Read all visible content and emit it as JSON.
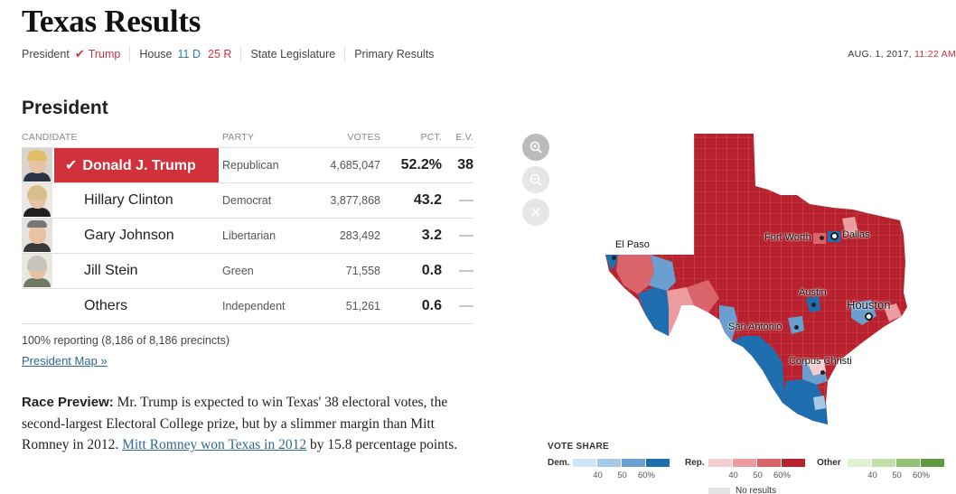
{
  "header": {
    "title": "Texas Results"
  },
  "subnav": {
    "president_label": "President",
    "president_winner": "Trump",
    "house_label": "House",
    "house_dem": "11 D",
    "house_rep": "25 R",
    "state_legislature": "State Legislature",
    "primary_results": "Primary Results",
    "date": "AUG. 1, 2017,",
    "time": "11:22 AM"
  },
  "president": {
    "section_title": "President",
    "columns": {
      "candidate": "CANDIDATE",
      "party": "PARTY",
      "votes": "VOTES",
      "pct": "PCT.",
      "ev": "E.V."
    },
    "rows": [
      {
        "name": "Donald J. Trump",
        "party": "Republican",
        "votes": "4,685,047",
        "pct": "52.2%",
        "ev": "38"
      },
      {
        "name": "Hillary Clinton",
        "party": "Democrat",
        "votes": "3,877,868",
        "pct": "43.2",
        "ev": "—"
      },
      {
        "name": "Gary Johnson",
        "party": "Libertarian",
        "votes": "283,492",
        "pct": "3.2",
        "ev": "—"
      },
      {
        "name": "Jill Stein",
        "party": "Green",
        "votes": "71,558",
        "pct": "0.8",
        "ev": "—"
      },
      {
        "name": "Others",
        "party": "Independent",
        "votes": "51,261",
        "pct": "0.6",
        "ev": "—"
      }
    ],
    "reporting": "100% reporting (8,186 of 8,186 precincts)",
    "map_link": "President Map »"
  },
  "preview": {
    "label": "Race Preview:",
    "text_before": " Mr. Trump is expected to win Texas' 38 electoral votes, the second-largest Electoral College prize, but by a slimmer margin than Mitt Romney in 2012. ",
    "link_text": "Mitt Romney won Texas in 2012",
    "text_after": " by 15.8 percentage points."
  },
  "map": {
    "cities": [
      "El Paso",
      "Fort Worth",
      "Dallas",
      "Austin",
      "Houston",
      "San Antonio",
      "Corpus Christi"
    ]
  },
  "legend": {
    "title": "VOTE SHARE",
    "groups": [
      {
        "name": "Dem.",
        "ticks": [
          "40",
          "50",
          "60%"
        ],
        "colors": [
          "#d0e4f4",
          "#a8c9e6",
          "#6a9fd0",
          "#1f6fb0"
        ]
      },
      {
        "name": "Rep.",
        "ticks": [
          "40",
          "50",
          "60%"
        ],
        "colors": [
          "#f6cdd0",
          "#ec9c9f",
          "#d9646a",
          "#b8222e"
        ]
      },
      {
        "name": "Other",
        "ticks": [
          "40",
          "50",
          "60%"
        ],
        "colors": [
          "#e2f0d6",
          "#c2deab",
          "#93c176",
          "#5f9a3f"
        ]
      }
    ],
    "no_results": "No results"
  },
  "colors": {
    "rep": "#d0323c",
    "dem": "#2c79b5",
    "link": "#326891"
  }
}
